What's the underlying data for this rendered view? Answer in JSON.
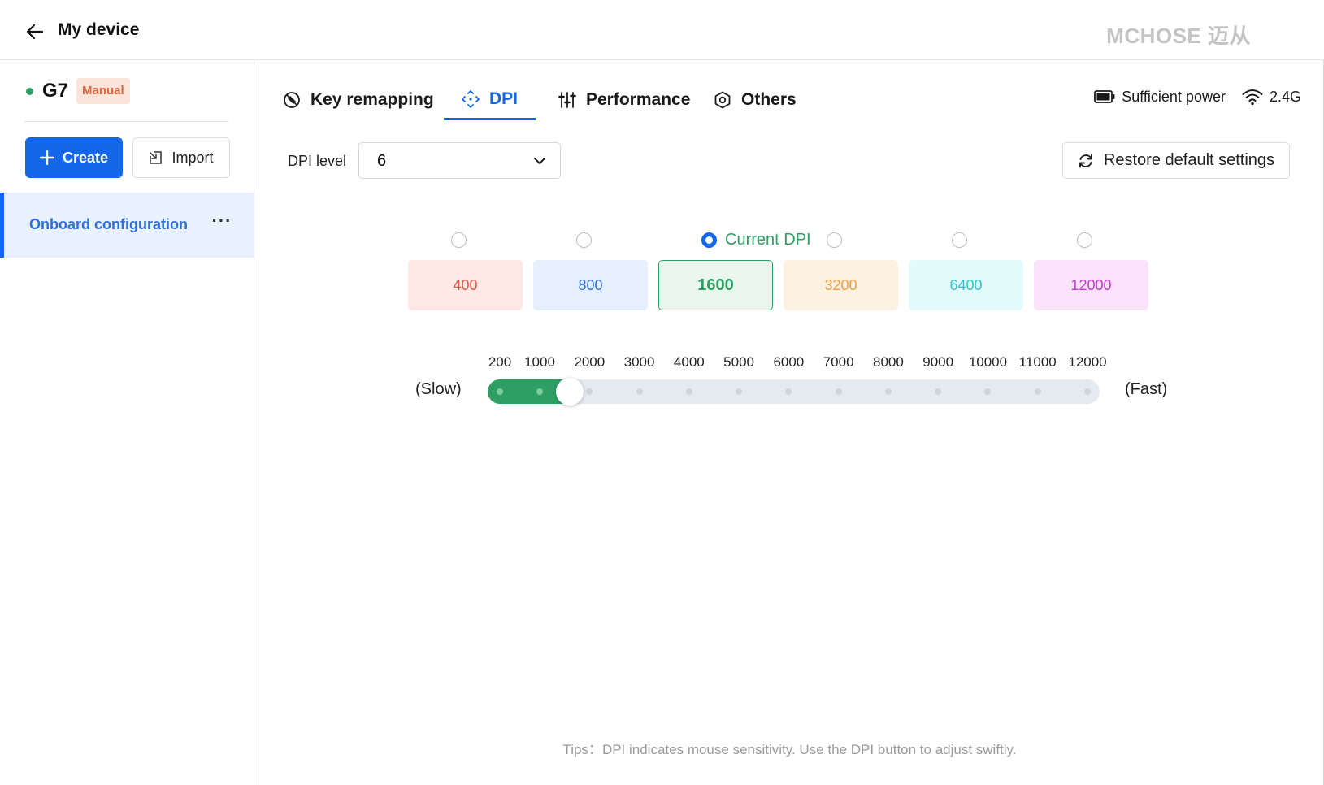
{
  "header": {
    "title": "My device",
    "brand": "MCHOSE 迈从"
  },
  "sidebar": {
    "device_name": "G7",
    "mode_badge": "Manual",
    "create_label": "Create",
    "import_label": "Import",
    "config_items": [
      {
        "label": "Onboard configuration",
        "more": "···",
        "active": true
      }
    ]
  },
  "tabs": [
    {
      "label": "Key remapping",
      "icon": "key-remap-icon"
    },
    {
      "label": "DPI",
      "icon": "dpi-icon",
      "active": true
    },
    {
      "label": "Performance",
      "icon": "sliders-icon"
    },
    {
      "label": "Others",
      "icon": "hexagon-settings-icon"
    }
  ],
  "status": {
    "power": "Sufficient power",
    "connection": "2.4G"
  },
  "dpi_level": {
    "label": "DPI level",
    "value": "6"
  },
  "restore_label": "Restore default settings",
  "current_dpi_label": "Current DPI",
  "dpi_stages": [
    {
      "value": "400",
      "bg": "#fde8e6",
      "color": "#e2574c",
      "selected": false
    },
    {
      "value": "800",
      "bg": "#e6effd",
      "color": "#2f6fd6",
      "selected": false
    },
    {
      "value": "1600",
      "bg": "#e9f6ee",
      "color": "#2e9f62",
      "selected": true
    },
    {
      "value": "3200",
      "bg": "#fdf1e2",
      "color": "#f0a040",
      "selected": false
    },
    {
      "value": "6400",
      "bg": "#e4fbfb",
      "color": "#2ec4c8",
      "selected": false
    },
    {
      "value": "12000",
      "bg": "#fbe4fb",
      "color": "#c836d8",
      "selected": false
    }
  ],
  "slider": {
    "min": 200,
    "max": 12000,
    "value": 1600,
    "ticks": [
      "200",
      "1000",
      "2000",
      "3000",
      "4000",
      "5000",
      "6000",
      "7000",
      "8000",
      "9000",
      "10000",
      "11000",
      "12000"
    ],
    "slow_label": "(Slow)",
    "fast_label": "(Fast)",
    "fill_color": "#2e9f62"
  },
  "tips": "Tips：DPI indicates mouse sensitivity. Use the DPI button to adjust swiftly."
}
